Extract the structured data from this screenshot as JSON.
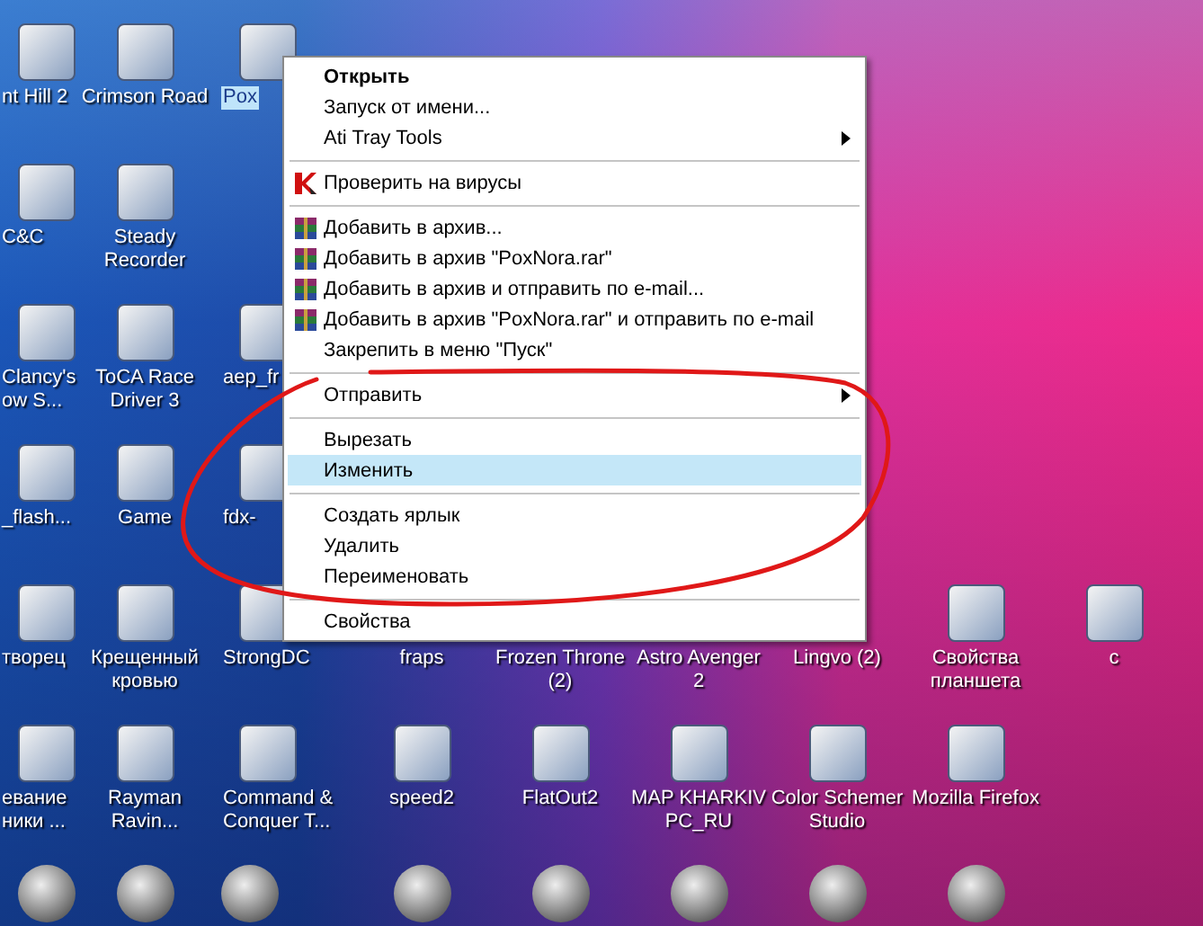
{
  "desktop": {
    "icon_rows": [
      {
        "icons": [
          {
            "label": "nt Hill 2",
            "kind": "tile",
            "selected": false
          },
          {
            "label": "Crimson Road",
            "kind": "tile",
            "selected": false
          },
          {
            "label": "Pox",
            "kind": "tile",
            "selected": true
          }
        ]
      },
      {
        "icons": [
          {
            "label": "C&C",
            "kind": "tile",
            "selected": false
          },
          {
            "label": "Steady Recorder",
            "kind": "tile",
            "selected": false
          }
        ]
      },
      {
        "icons": [
          {
            "label": "Clancy's\now S...",
            "kind": "tile",
            "selected": false
          },
          {
            "label": "ToCA Race Driver 3",
            "kind": "tile",
            "selected": false
          },
          {
            "label": "aep_fr",
            "kind": "tile",
            "selected": false
          }
        ]
      },
      {
        "icons": [
          {
            "label": "_flash...",
            "kind": "tile",
            "selected": false
          },
          {
            "label": "Game",
            "kind": "tile",
            "selected": false
          },
          {
            "label": "fdx-",
            "kind": "tile",
            "selected": false
          }
        ]
      },
      {
        "icons": [
          {
            "label": "творец",
            "kind": "tile",
            "selected": false
          },
          {
            "label": "Крещенный кровью",
            "kind": "tile",
            "selected": false
          },
          {
            "label": "StrongDC",
            "kind": "tile",
            "selected": false
          },
          {
            "label": "fraps",
            "kind": "tile",
            "selected": false
          },
          {
            "label": "Frozen Throne (2)",
            "kind": "tile",
            "selected": false
          },
          {
            "label": "Astro Avenger 2",
            "kind": "tile",
            "selected": false
          },
          {
            "label": "Lingvo (2)",
            "kind": "tile",
            "selected": false
          },
          {
            "label": "Свойства планшета",
            "kind": "tile",
            "selected": false
          },
          {
            "label": "c",
            "kind": "tile",
            "selected": false
          }
        ]
      },
      {
        "icons": [
          {
            "label": "евание\nники ...",
            "kind": "tile",
            "selected": false
          },
          {
            "label": "Rayman Ravin...",
            "kind": "tile",
            "selected": false
          },
          {
            "label": "Command & Conquer T...",
            "kind": "tile",
            "selected": false
          },
          {
            "label": "speed2",
            "kind": "tile",
            "selected": false
          },
          {
            "label": "FlatOut2",
            "kind": "tile",
            "selected": false
          },
          {
            "label": "MAP KHARKIV PC_RU",
            "kind": "tile",
            "selected": false
          },
          {
            "label": "Color Schemer Studio",
            "kind": "tile",
            "selected": false
          },
          {
            "label": "Mozilla Firefox",
            "kind": "tile",
            "selected": false
          }
        ]
      },
      {
        "icons": [
          {
            "kind": "emblem"
          },
          {
            "kind": "emblem"
          },
          {
            "kind": "emblem"
          },
          {
            "kind": "emblem"
          },
          {
            "kind": "emblem"
          },
          {
            "kind": "emblem"
          },
          {
            "kind": "emblem"
          },
          {
            "kind": "emblem"
          }
        ]
      }
    ]
  },
  "context_menu": {
    "items": [
      {
        "kind": "item",
        "label": "Открыть",
        "default": true,
        "submenu": false,
        "selected": false
      },
      {
        "kind": "item",
        "label": "Запуск от имени...",
        "default": false,
        "submenu": false,
        "selected": false
      },
      {
        "kind": "item",
        "label": "Ati Tray Tools",
        "default": false,
        "submenu": true,
        "selected": false
      },
      {
        "kind": "separator"
      },
      {
        "kind": "scan",
        "label": "Проверить на вирусы",
        "default": false,
        "submenu": false,
        "selected": false
      },
      {
        "kind": "separator"
      },
      {
        "kind": "archive",
        "label": "Добавить в архив...",
        "default": false,
        "submenu": false,
        "selected": false
      },
      {
        "kind": "archive",
        "label": "Добавить в архив \"PoxNora.rar\"",
        "default": false,
        "submenu": false,
        "selected": false
      },
      {
        "kind": "archive",
        "label": "Добавить в архив и отправить по e-mail...",
        "default": false,
        "submenu": false,
        "selected": false
      },
      {
        "kind": "archive",
        "label": "Добавить в архив \"PoxNora.rar\" и отправить по e-mail",
        "default": false,
        "submenu": false,
        "selected": false
      },
      {
        "kind": "item",
        "label": "Закрепить в меню \"Пуск\"",
        "default": false,
        "submenu": false,
        "selected": false
      },
      {
        "kind": "separator"
      },
      {
        "kind": "item",
        "label": "Отправить",
        "default": false,
        "submenu": true,
        "selected": false
      },
      {
        "kind": "separator"
      },
      {
        "kind": "item",
        "label": "Вырезать",
        "default": false,
        "submenu": false,
        "selected": false
      },
      {
        "kind": "item",
        "label": "Изменить",
        "default": false,
        "submenu": false,
        "selected": true
      },
      {
        "kind": "separator"
      },
      {
        "kind": "item",
        "label": "Создать ярлык",
        "default": false,
        "submenu": false,
        "selected": false
      },
      {
        "kind": "item",
        "label": "Удалить",
        "default": false,
        "submenu": false,
        "selected": false
      },
      {
        "kind": "item",
        "label": "Переименовать",
        "default": false,
        "submenu": false,
        "selected": false
      },
      {
        "kind": "separator"
      },
      {
        "kind": "item",
        "label": "Свойства",
        "default": false,
        "submenu": false,
        "selected": false
      }
    ]
  }
}
